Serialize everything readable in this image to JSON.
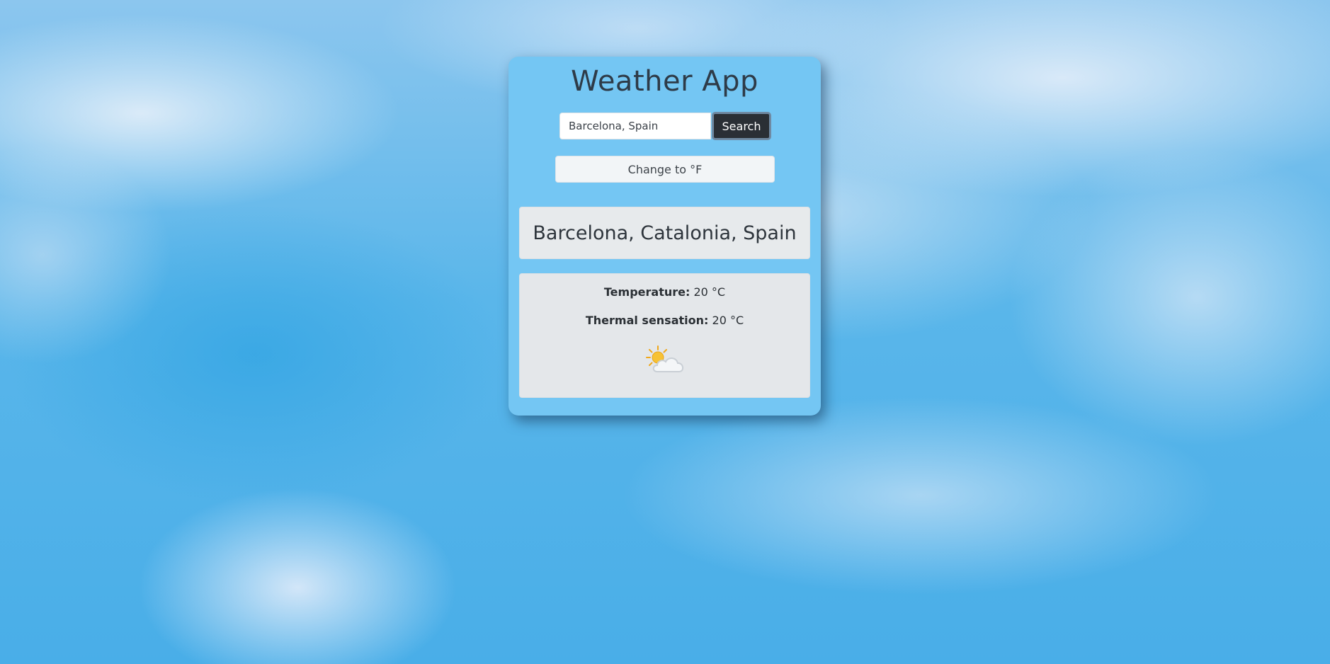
{
  "app": {
    "title": "Weather App"
  },
  "search": {
    "value": "Barcelona, Spain",
    "button_label": "Search"
  },
  "unit_toggle": {
    "label": "Change to °F"
  },
  "location": {
    "name": "Barcelona, Catalonia, Spain"
  },
  "weather": {
    "temperature_label": "Temperature:",
    "temperature_value": "20 °C",
    "thermal_label": "Thermal sensation:",
    "thermal_value": "20 °C",
    "icon": "partly-cloudy-icon"
  },
  "colors": {
    "card_background": "#74c6f3",
    "search_button": "#2a2f35",
    "panel_background": "#e4e7ea",
    "sun": "#f5b82e"
  }
}
